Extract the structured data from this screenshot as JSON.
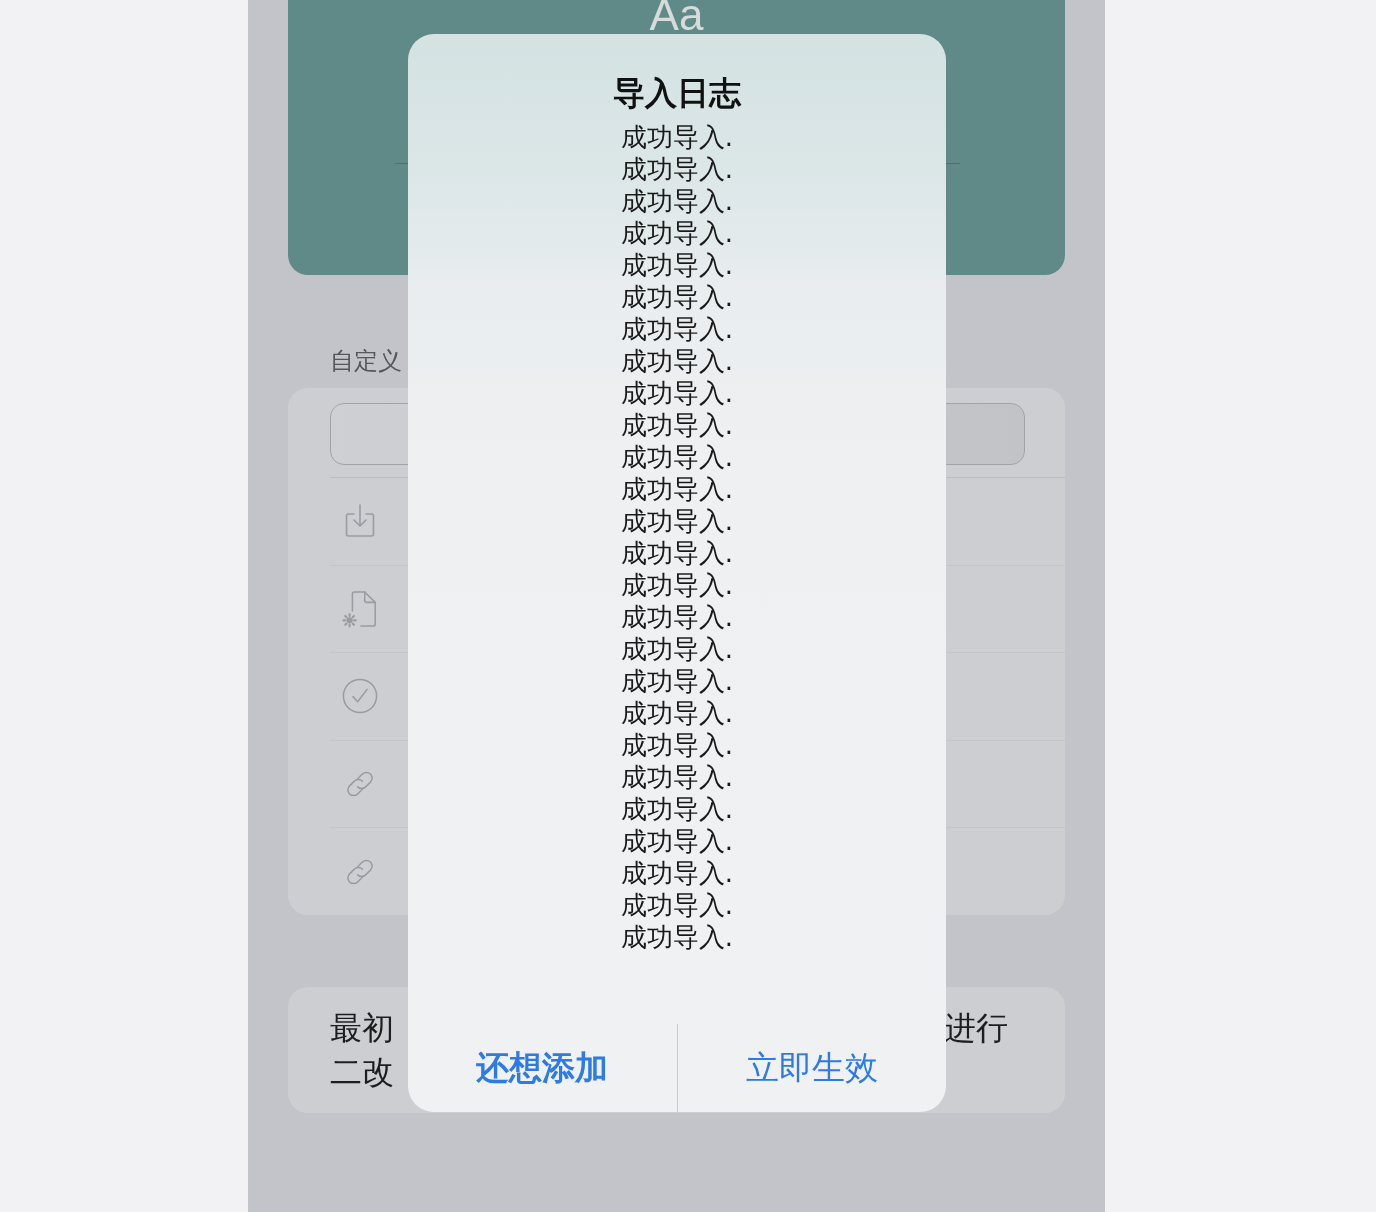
{
  "background_screen": {
    "preview_card": {
      "sample": "Aa"
    },
    "section_label": "自定义",
    "list_card": {
      "rows": [
        {
          "kind": "download"
        },
        {
          "kind": "document-settings"
        },
        {
          "kind": "check"
        },
        {
          "kind": "link"
        },
        {
          "kind": "link"
        }
      ]
    },
    "notes_card": {
      "line_1_left": "最初",
      "line_1_right": "进行",
      "line_2": "二改"
    }
  },
  "dialog": {
    "title": "导入日志",
    "messages": [
      "成功导入.",
      "成功导入.",
      "成功导入.",
      "成功导入.",
      "成功导入.",
      "成功导入.",
      "成功导入.",
      "成功导入.",
      "成功导入.",
      "成功导入.",
      "成功导入.",
      "成功导入.",
      "成功导入.",
      "成功导入.",
      "成功导入.",
      "成功导入.",
      "成功导入.",
      "成功导入.",
      "成功导入.",
      "成功导入.",
      "成功导入.",
      "成功导入.",
      "成功导入.",
      "成功导入.",
      "成功导入.",
      "成功导入."
    ],
    "buttons": [
      {
        "label": "还想添加",
        "kind": "preferred"
      },
      {
        "label": "立即生效",
        "kind": "default"
      }
    ]
  }
}
